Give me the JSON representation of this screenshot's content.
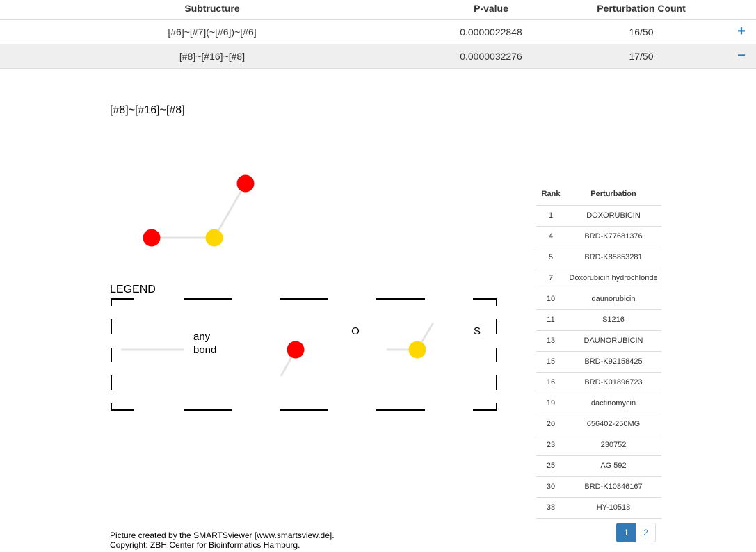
{
  "table": {
    "headers": {
      "substructure": "Subtructure",
      "pvalue": "P-value",
      "count": "Perturbation Count"
    },
    "rows": [
      {
        "substructure": "[#6]~[#7](~[#6])~[#6]",
        "pvalue": "0.0000022848",
        "count": "16/50",
        "toggle": "+",
        "expanded": false
      },
      {
        "substructure": "[#8]~[#16]~[#8]",
        "pvalue": "0.0000032276",
        "count": "17/50",
        "toggle": "−",
        "expanded": true
      }
    ]
  },
  "detail": {
    "title": "[#8]~[#16]~[#8]",
    "legend": {
      "title": "LEGEND",
      "any_bond_line1": "any",
      "any_bond_line2": "bond",
      "oxygen_label": "O",
      "sulfur_label": "S"
    },
    "colors": {
      "oxygen": "#ff0000",
      "sulfur": "#ffd700",
      "bond": "#e3e3e3",
      "accent": "#337ab7"
    }
  },
  "perturbations": {
    "headers": {
      "rank": "Rank",
      "perturbation": "Perturbation"
    },
    "rows": [
      {
        "rank": "1",
        "name": "DOXORUBICIN"
      },
      {
        "rank": "4",
        "name": "BRD-K77681376"
      },
      {
        "rank": "5",
        "name": "BRD-K85853281"
      },
      {
        "rank": "7",
        "name": "Doxorubicin hydrochloride"
      },
      {
        "rank": "10",
        "name": "daunorubicin"
      },
      {
        "rank": "11",
        "name": "S1216"
      },
      {
        "rank": "13",
        "name": "DAUNORUBICIN"
      },
      {
        "rank": "15",
        "name": "BRD-K92158425"
      },
      {
        "rank": "16",
        "name": "BRD-K01896723"
      },
      {
        "rank": "19",
        "name": "dactinomycin"
      },
      {
        "rank": "20",
        "name": "656402-250MG"
      },
      {
        "rank": "23",
        "name": "230752"
      },
      {
        "rank": "25",
        "name": "AG 592"
      },
      {
        "rank": "30",
        "name": "BRD-K10846167"
      },
      {
        "rank": "38",
        "name": "HY-10518"
      }
    ],
    "pages": [
      "1",
      "2"
    ],
    "active_page": "1"
  },
  "credit": {
    "line1": "Picture created by the SMARTSviewer [www.smartsview.de].",
    "line2": "Copyright: ZBH Center for Bioinformatics Hamburg."
  }
}
